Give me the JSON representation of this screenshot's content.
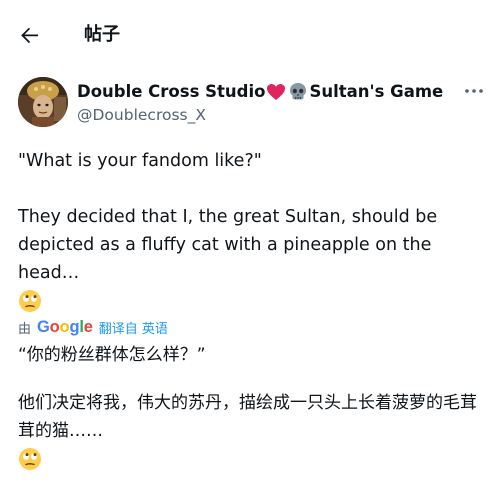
{
  "header": {
    "title": "帖子",
    "back_icon": "arrow-left-icon"
  },
  "post": {
    "author": {
      "name_part1": "Double Cross Studio",
      "name_part2": "Sultan's Game",
      "name_emojis": [
        "red-heart-icon",
        "skull-icon"
      ],
      "handle": "@Doublecross_X"
    },
    "more_icon": "more-horizontal-icon",
    "text": {
      "line1": "\"What is your fandom like?\"",
      "line2": "They decided that I, the great Sultan, should be depicted as a fluffy cat with a pineapple on the head…",
      "emoji": "face-with-rolling-eyes-icon"
    },
    "translation": {
      "by": "由",
      "provider": "Google",
      "link": "翻译自 英语",
      "line1": "“你的粉丝群体怎么样？”",
      "line2": "他们决定将我，伟大的苏丹，描绘成一只头上长着菠萝的毛茸茸的猫……",
      "emoji": "face-with-rolling-eyes-icon"
    }
  },
  "colors": {
    "text": "#0f1419",
    "secondary": "#536471",
    "link": "#1d9bf0"
  }
}
